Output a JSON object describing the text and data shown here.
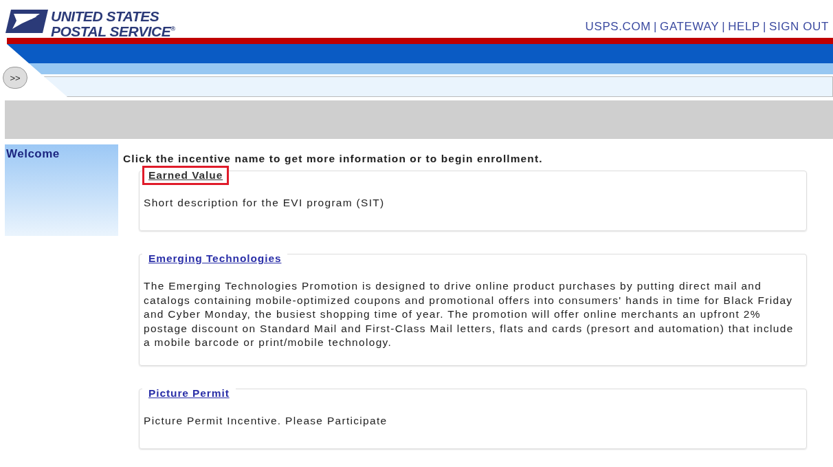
{
  "logo": {
    "lines": [
      "UNITED STATES",
      "POSTAL SERVICE"
    ],
    "mark": "®"
  },
  "header_links": {
    "items": [
      "USPS.COM",
      "GATEWAY",
      "HELP",
      "SIGN OUT"
    ],
    "separator": "|"
  },
  "toggle_button": {
    "label": ">>"
  },
  "sidebar": {
    "title": "Welcome"
  },
  "instruction": "Click the incentive name to get more information or to begin enrollment.",
  "incentives": [
    {
      "name": "Earned Value",
      "visited": true,
      "highlighted": true,
      "description": "Short description for the EVI program (SIT)"
    },
    {
      "name": "Emerging Technologies",
      "visited": false,
      "highlighted": false,
      "description": "The Emerging Technologies Promotion is designed to drive online product purchases by putting direct mail and catalogs containing mobile-optimized coupons and promotional offers into consumers' hands in time for Black Friday and Cyber Monday, the busiest shopping time of year. The promotion will offer online merchants  an upfront 2% postage discount on Standard Mail and First-Class  Mail letters, flats and cards (presort and automation) that include a mobile barcode or print/mobile technology."
    },
    {
      "name": "Picture Permit",
      "visited": false,
      "highlighted": false,
      "description": "Picture Permit Incentive. Please Participate"
    }
  ]
}
